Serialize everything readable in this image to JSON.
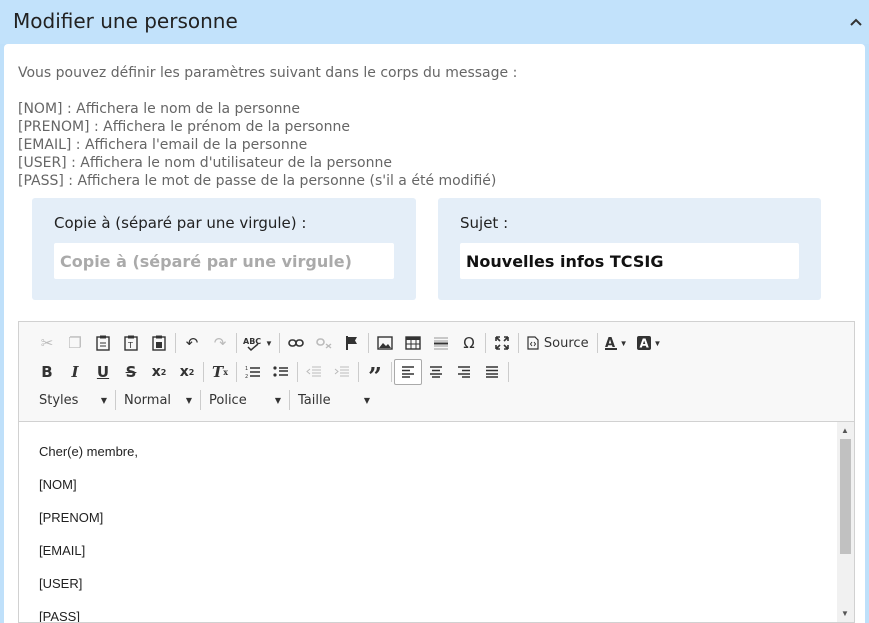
{
  "header": {
    "title": "Modifier une personne",
    "collapse_icon": "chevron-up-icon"
  },
  "intro": "Vous pouvez définir les paramètres suivant dans le corps du message :",
  "params": [
    "[NOM] : Affichera le nom de la personne",
    "[PRENOM] : Affichera le prénom de la personne",
    "[EMAIL] : Affichera l'email de la personne",
    "[USER] : Affichera le nom d'utilisateur de la personne",
    "[PASS] : Affichera le mot de passe de la personne (s'il a été modifié)"
  ],
  "cc": {
    "label": "Copie à (séparé par une virgule) :",
    "placeholder": "Copie à (séparé par une virgule)",
    "value": ""
  },
  "subject": {
    "label": "Sujet :",
    "value": "Nouvelles infos TCSIG"
  },
  "toolbar": {
    "source_label": "Source",
    "styles_label": "Styles",
    "format_label": "Normal",
    "font_label": "Police",
    "size_label": "Taille"
  },
  "body": {
    "lines": [
      "Cher(e) membre,",
      "[NOM]",
      "[PRENOM]",
      "[EMAIL]",
      "[USER]",
      "[PASS]"
    ]
  }
}
